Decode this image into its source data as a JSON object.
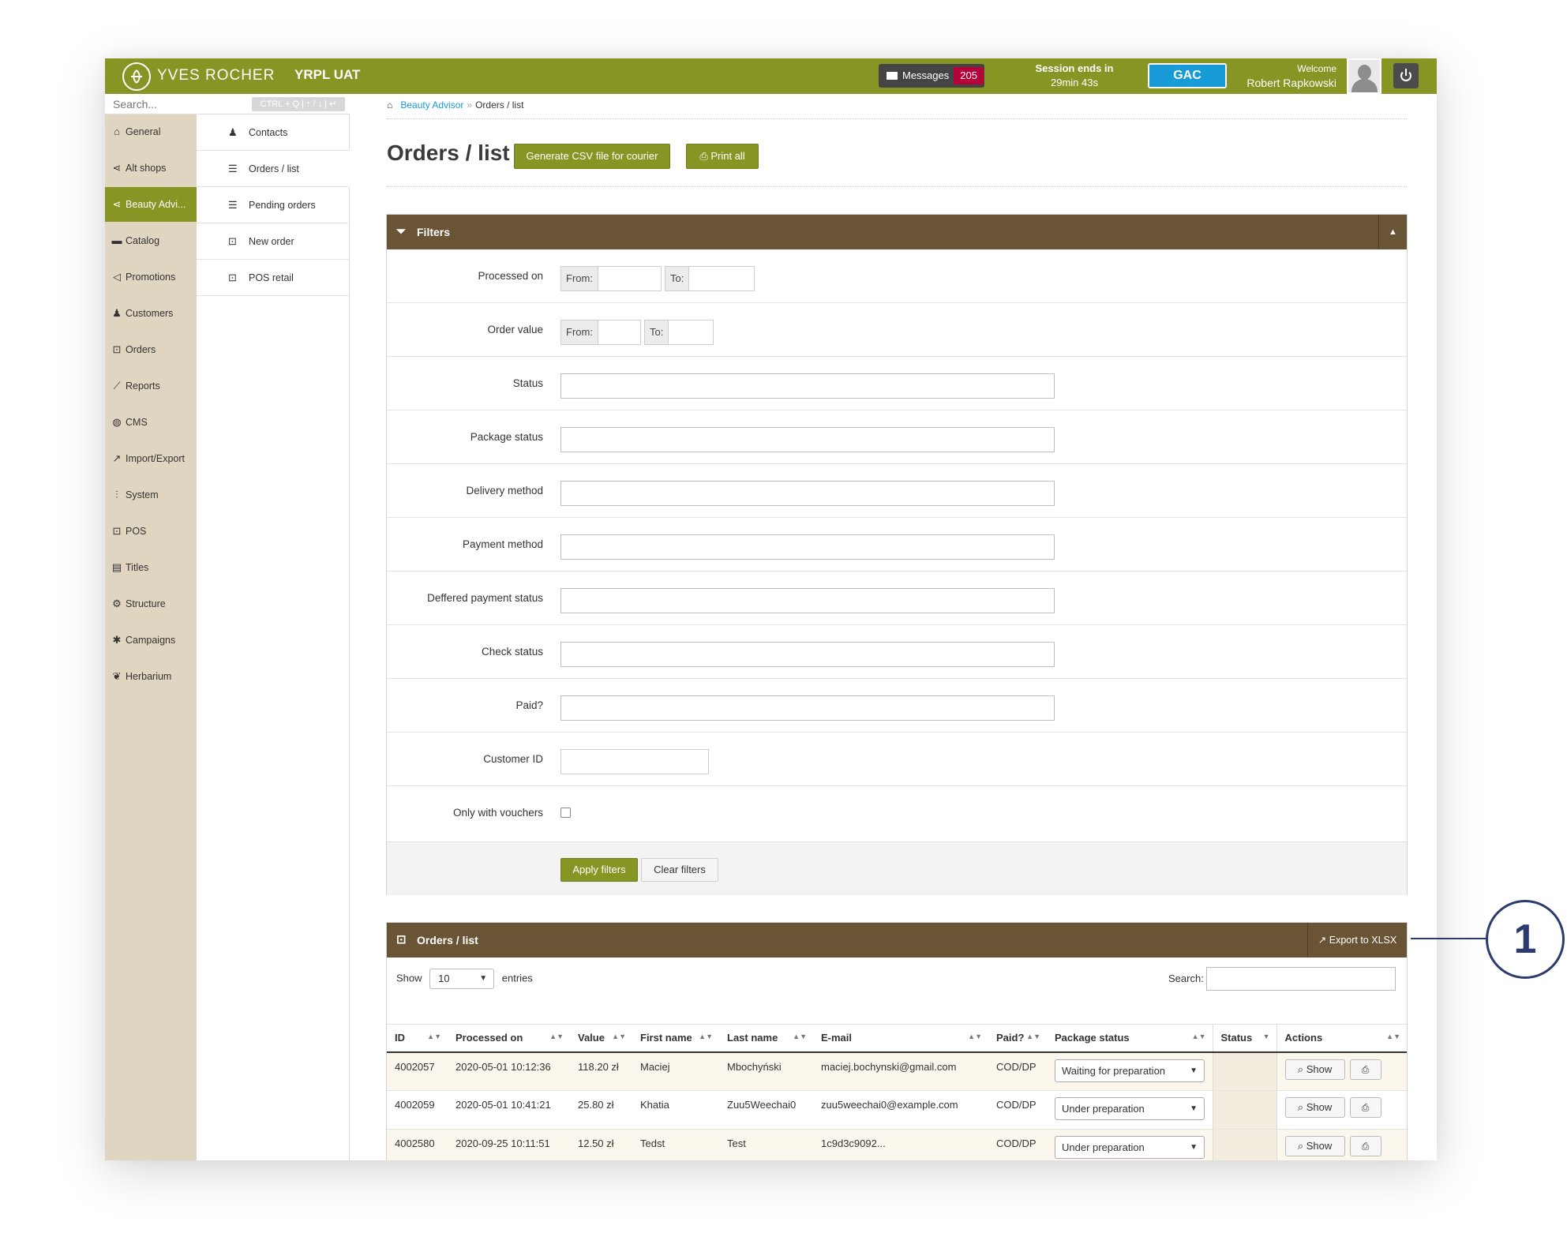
{
  "header": {
    "brand": "YVES ROCHER",
    "environment": "YRPL UAT",
    "messages_label": "Messages",
    "messages_count": "205",
    "session_label": "Session ends in",
    "session_time": "29min 43s",
    "gac_label": "GAC",
    "welcome_label": "Welcome",
    "user_name": "Robert Rapkowski"
  },
  "sidebar": {
    "search_placeholder": "Search...",
    "search_hint": "CTRL + Q | ↑ / ↓ | ↵",
    "items": [
      {
        "label": "General",
        "icon": "home-icon"
      },
      {
        "label": "Alt shops",
        "icon": "share-icon"
      },
      {
        "label": "Beauty Advi...",
        "icon": "share-icon"
      },
      {
        "label": "Catalog",
        "icon": "folder-icon"
      },
      {
        "label": "Promotions",
        "icon": "megaphone-icon"
      },
      {
        "label": "Customers",
        "icon": "users-icon"
      },
      {
        "label": "Orders",
        "icon": "cart-icon"
      },
      {
        "label": "Reports",
        "icon": "chart-icon"
      },
      {
        "label": "CMS",
        "icon": "globe-icon"
      },
      {
        "label": "Import/Export",
        "icon": "share-arrow-icon"
      },
      {
        "label": "System",
        "icon": "sliders-icon"
      },
      {
        "label": "POS",
        "icon": "cart-icon"
      },
      {
        "label": "Titles",
        "icon": "list-box-icon"
      },
      {
        "label": "Structure",
        "icon": "gear-icon"
      },
      {
        "label": "Campaigns",
        "icon": "asterisk-icon"
      },
      {
        "label": "Herbarium",
        "icon": "leaf-icon"
      }
    ],
    "active_item": "Beauty Advi..."
  },
  "submenu": {
    "items": [
      {
        "label": "Contacts",
        "icon": "users-icon"
      },
      {
        "label": "Orders / list",
        "icon": "list-icon"
      },
      {
        "label": "Pending orders",
        "icon": "list-icon"
      },
      {
        "label": "New order",
        "icon": "cart-icon"
      },
      {
        "label": "POS retail",
        "icon": "cart-icon"
      }
    ]
  },
  "breadcrumb": {
    "link": "Beauty Advisor",
    "separator": "»",
    "current": "Orders / list"
  },
  "page": {
    "title": "Orders / list",
    "csv_button": "Generate CSV file for courier",
    "print_all_button": "Print all"
  },
  "filters": {
    "title": "Filters",
    "from_label": "From:",
    "to_label": "To:",
    "rows": [
      {
        "label": "Processed on"
      },
      {
        "label": "Order value"
      },
      {
        "label": "Status"
      },
      {
        "label": "Package status"
      },
      {
        "label": "Delivery method"
      },
      {
        "label": "Payment method"
      },
      {
        "label": "Deffered payment status"
      },
      {
        "label": "Check status"
      },
      {
        "label": "Paid?"
      },
      {
        "label": "Customer ID"
      },
      {
        "label": "Only with vouchers"
      }
    ],
    "apply_button": "Apply filters",
    "clear_button": "Clear filters"
  },
  "orders": {
    "title": "Orders / list",
    "export_button": "Export to XLSX",
    "show_label": "Show",
    "page_size": "10",
    "entries_label": "entries",
    "search_label": "Search:",
    "columns": [
      "ID",
      "Processed on",
      "Value",
      "First name",
      "Last name",
      "E-mail",
      "Paid?",
      "Package status",
      "Status",
      "Actions"
    ],
    "show_button": "Show",
    "rows": [
      {
        "id": "4002057",
        "processed": "2020-05-01 10:12:36",
        "value": "118.20 zł",
        "first": "Maciej",
        "last": "Mbochyński",
        "email": "maciej.bochynski@gmail.com",
        "paid": "COD/DP",
        "package_status": "Waiting for preparation",
        "status": ""
      },
      {
        "id": "4002059",
        "processed": "2020-05-01 10:41:21",
        "value": "25.80 zł",
        "first": "Khatia",
        "last": "Zuu5Weechai0",
        "email": "zuu5weechai0@example.com",
        "paid": "COD/DP",
        "package_status": "Under preparation",
        "status": ""
      },
      {
        "id": "4002580",
        "processed": "2020-09-25 10:11:51",
        "value": "12.50 zł",
        "first": "Tedst",
        "last": "Test",
        "email": "1c9d3c9092...",
        "paid": "COD/DP",
        "package_status": "Under preparation",
        "status": ""
      }
    ]
  },
  "callout": {
    "number": "1"
  },
  "colors": {
    "accent_green": "#869523",
    "panel_brown": "#6a5436",
    "sidebar_beige": "#e0d5c0",
    "link_blue": "#179bd7",
    "badge_red": "#b80039",
    "callout_navy": "#2b3b6e"
  }
}
